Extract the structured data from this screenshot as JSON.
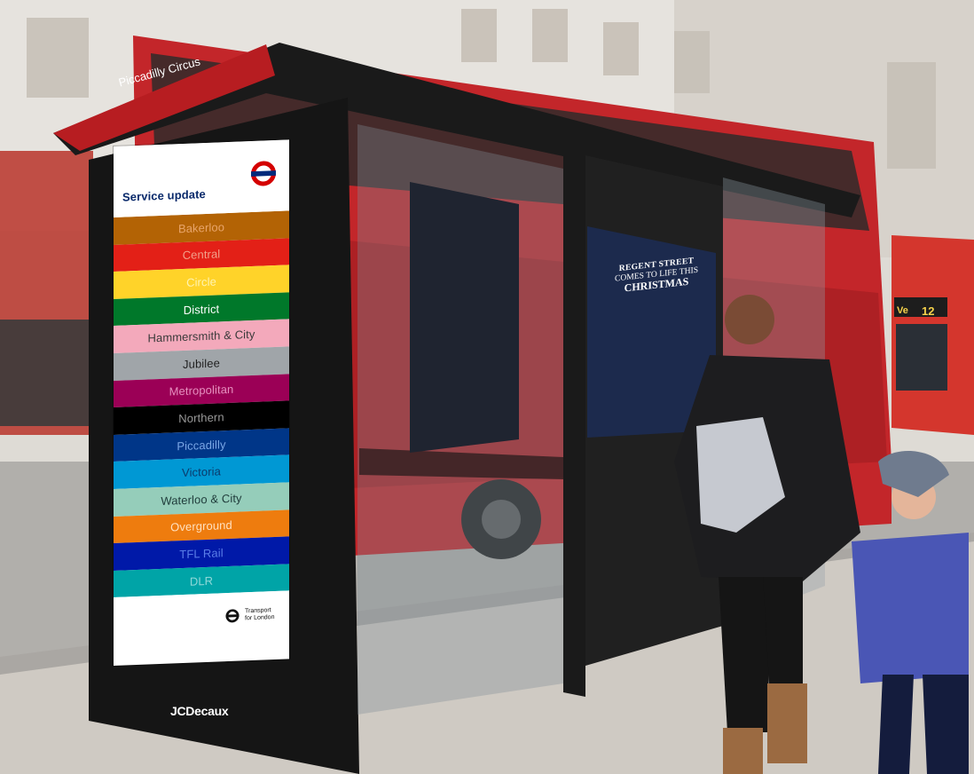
{
  "shelter_sign": "Piccadilly Circus",
  "brand": "JCDecaux",
  "bus": {
    "destination": "Ve",
    "route": "12"
  },
  "poster": {
    "line1": "REGENT STREET",
    "line2": "COMES TO LIFE THIS",
    "line3": "CHRISTMAS"
  },
  "panel": {
    "title": "Service update",
    "logo_icon": "tfl-roundel-icon",
    "footer_text": "Transport for London",
    "lines": [
      {
        "name": "Bakerloo",
        "color": "#B36305",
        "text": "#E9A56A"
      },
      {
        "name": "Central",
        "color": "#E32017",
        "text": "#F2A08A"
      },
      {
        "name": "Circle",
        "color": "#FFD329",
        "text": "#FFF3B0"
      },
      {
        "name": "District",
        "color": "#00782A",
        "text": "#ffffff"
      },
      {
        "name": "Hammersmith & City",
        "color": "#F3A9BB",
        "text": "#3a3a3a"
      },
      {
        "name": "Jubilee",
        "color": "#A0A5A9",
        "text": "#1f1f1f"
      },
      {
        "name": "Metropolitan",
        "color": "#9B0056",
        "text": "#E68FBF"
      },
      {
        "name": "Northern",
        "color": "#000000",
        "text": "#9a9a9a"
      },
      {
        "name": "Piccadilly",
        "color": "#003688",
        "text": "#7BA7E6"
      },
      {
        "name": "Victoria",
        "color": "#0098D4",
        "text": "#0b3a6b"
      },
      {
        "name": "Waterloo & City",
        "color": "#95CDBA",
        "text": "#1f3b3a"
      },
      {
        "name": "Overground",
        "color": "#EE7C0E",
        "text": "#FFE0BF"
      },
      {
        "name": "TFL Rail",
        "color": "#0019A8",
        "text": "#5B7EE8"
      },
      {
        "name": "DLR",
        "color": "#00A4A7",
        "text": "#8ED8D8"
      }
    ]
  }
}
